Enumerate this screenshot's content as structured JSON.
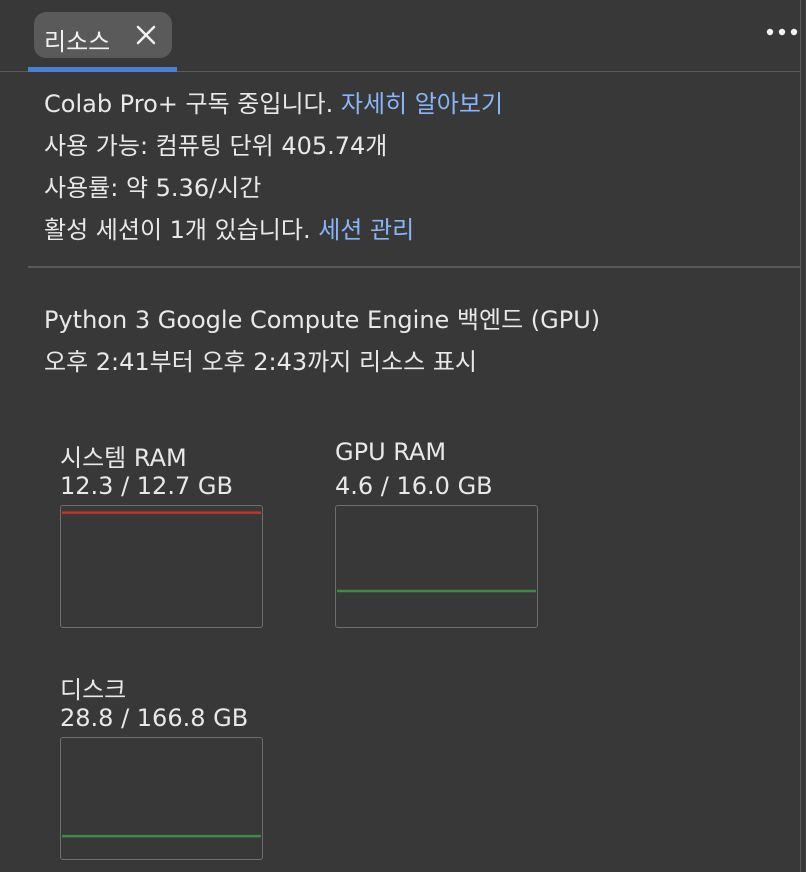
{
  "tab": {
    "label": "리소스"
  },
  "info": {
    "subscription_text": "Colab Pro+ 구독 중입니다. ",
    "learn_more_link": "자세히 알아보기",
    "available_text": "사용 가능: 컴퓨팅 단위 405.74개",
    "usage_rate_text": "사용률: 약 5.36/시간",
    "active_sessions_text": "활성 세션이 1개 있습니다. ",
    "manage_sessions_link": "세션 관리"
  },
  "backend": {
    "title": "Python 3 Google Compute Engine 백엔드 (GPU)",
    "time_range": "오후 2:41부터 오후 2:43까지 리소스 표시"
  },
  "metrics": {
    "system_ram": {
      "label": "시스템 RAM",
      "value": "12.3 / 12.7 GB",
      "used": 12.3,
      "total": 12.7,
      "line_color": "#c5332b"
    },
    "gpu_ram": {
      "label": "GPU RAM",
      "value": "4.6 / 16.0 GB",
      "used": 4.6,
      "total": 16.0,
      "line_color": "#3f8a43"
    },
    "disk": {
      "label": "디스크",
      "value": "28.8 / 166.8 GB",
      "used": 28.8,
      "total": 166.8,
      "line_color": "#3f8a43"
    }
  },
  "colors": {
    "background": "#383838",
    "accent": "#4a7fd2",
    "link": "#8ab4f8"
  }
}
